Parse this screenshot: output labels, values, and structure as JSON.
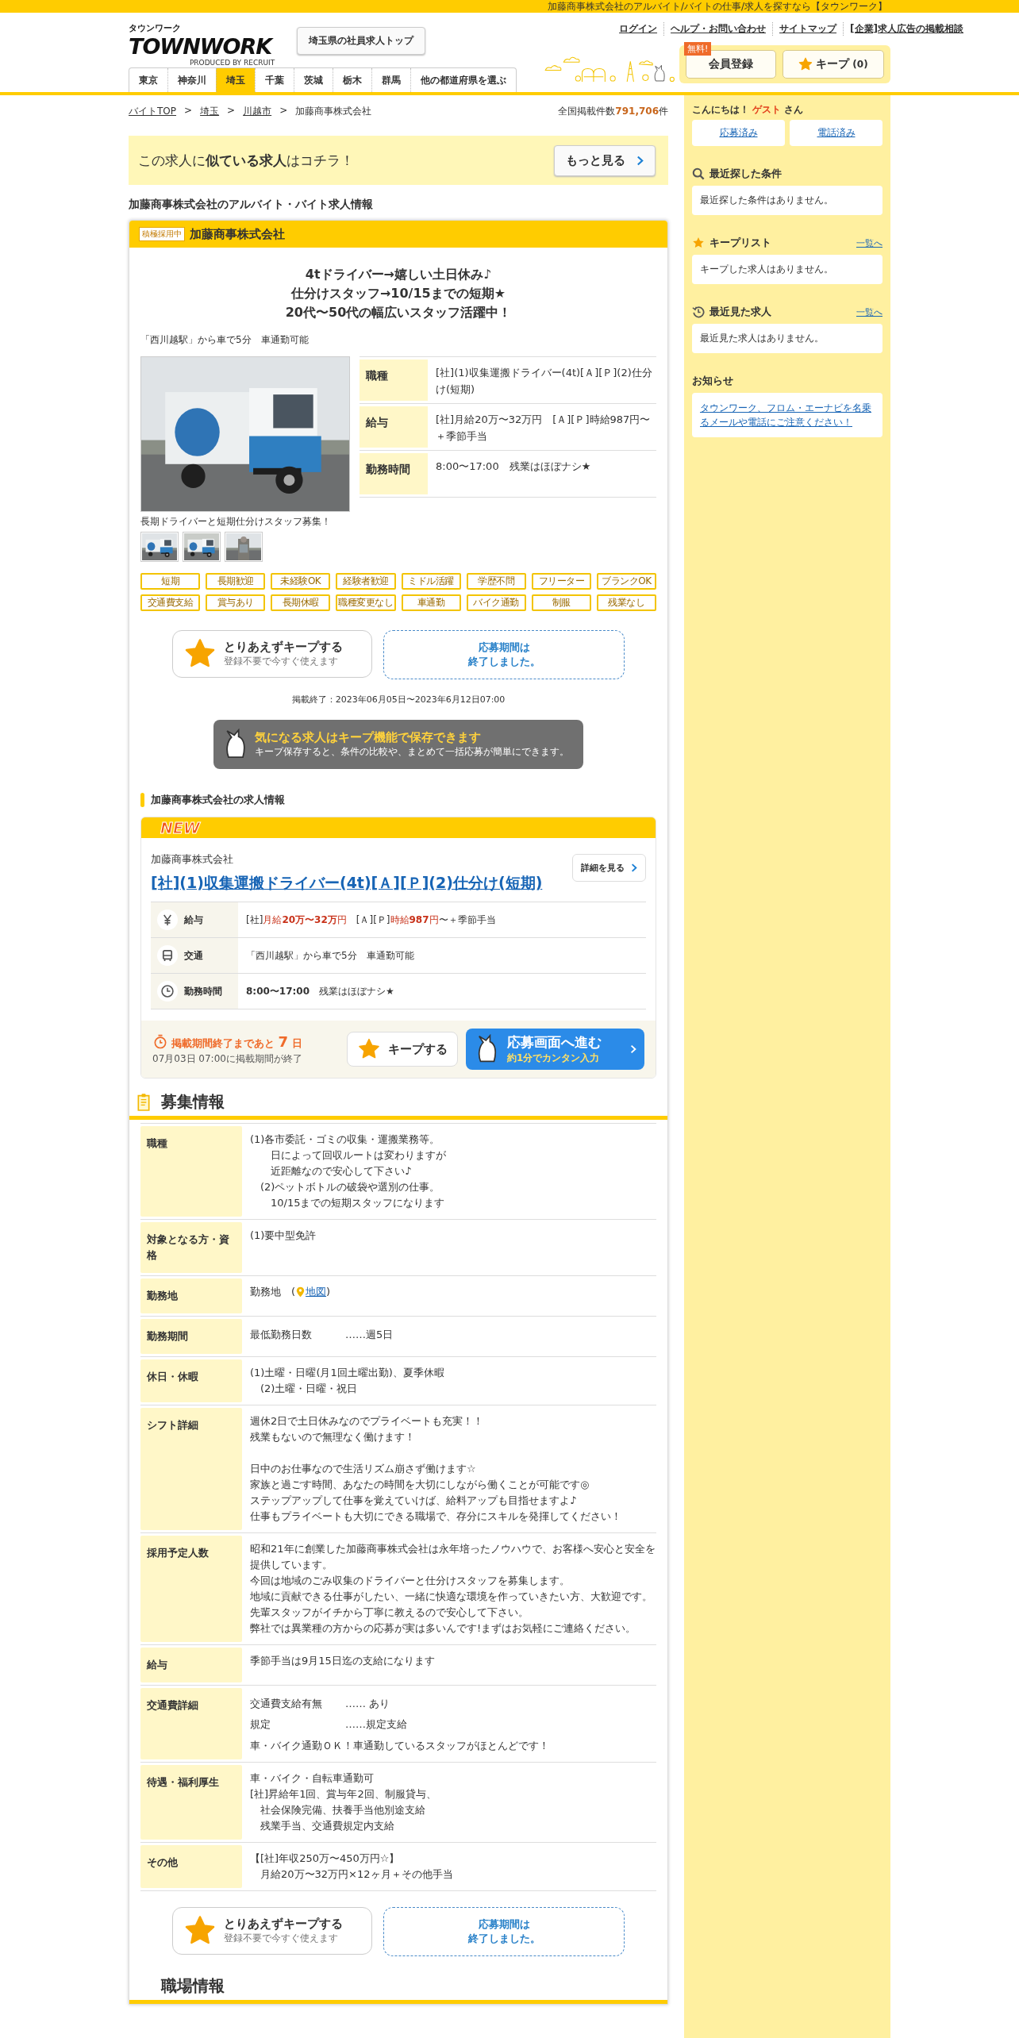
{
  "top_bar": {
    "text": "加藤商事株式会社のアルバイト/バイトの仕事/求人を探すなら【タウンワーク】"
  },
  "logo": {
    "kana": "タウンワーク",
    "wordmark": "TOWNWORK",
    "credit": "PRODUCED BY RECRUIT"
  },
  "top_button": "埼玉県の社員求人トップ",
  "util_links": [
    "ログイン",
    "ヘルプ・お問い合わせ",
    "サイトマップ",
    "[企業]求人広告の掲載相談"
  ],
  "member_button": {
    "badge": "無料!",
    "label": "会員登録"
  },
  "keep_button": {
    "label": "キープ",
    "count": "(0)"
  },
  "prefecture_tabs": [
    {
      "label": "東京",
      "selected": false
    },
    {
      "label": "神奈川",
      "selected": false
    },
    {
      "label": "埼玉",
      "selected": true
    },
    {
      "label": "千葉",
      "selected": false
    },
    {
      "label": "茨城",
      "selected": false
    },
    {
      "label": "栃木",
      "selected": false
    },
    {
      "label": "群馬",
      "selected": false
    },
    {
      "label": "他の都道府県を選ぶ",
      "selected": false
    }
  ],
  "breadcrumb": {
    "separator": ">",
    "items": [
      {
        "label": "バイトTOP",
        "link": true
      },
      {
        "label": "埼玉",
        "link": true
      },
      {
        "label": "川越市",
        "link": true
      },
      {
        "label": "加藤商事株式会社",
        "link": false
      }
    ]
  },
  "total": {
    "label": "全国掲載件数",
    "count": "791,706",
    "unit": "件"
  },
  "similar_banner": {
    "text": "この求人に**似ている求人**はコチラ！",
    "button": "もっと見る"
  },
  "page_heading": "加藤商事株式会社のアルバイト・バイト求人情報",
  "job": {
    "badge": "積極採用中",
    "company": "加藤商事株式会社",
    "catch_lines": [
      "4tドライバー→嬉しい土日休み♪",
      "仕分けスタッフ→10/15までの短期★",
      "20代〜50代の幅広いスタッフ活躍中！"
    ],
    "access": "「西川越駅」から車で5分　車通勤可能",
    "photo": {
      "kind": "picture",
      "caption": "長期ドライバーと短期仕分けスタッフ募集！"
    },
    "thumbnails": [
      {
        "kind": "picture"
      },
      {
        "kind": "picture"
      },
      {
        "kind": "picture"
      }
    ],
    "summary": [
      {
        "label": "職種",
        "value": "[社](1)収集運搬ドライバー(4t)[Ａ][Ｐ](2)仕分け(短期)"
      },
      {
        "label": "給与",
        "value": "[社]月給20万〜32万円　[Ａ][Ｐ]時給987円〜＋季節手当"
      },
      {
        "label": "勤務時間",
        "value": "8:00〜17:00　残業はほぼナシ★"
      }
    ],
    "tags": [
      "短期",
      "長期歓迎",
      "未経験OK",
      "経験者歓迎",
      "ミドル活躍",
      "学歴不問",
      "フリーター",
      "ブランクOK",
      "交通費支給",
      "賞与あり",
      "長期休暇",
      "職種変更なし",
      "車通勤",
      "バイク通勤",
      "制服",
      "残業なし"
    ],
    "keep_action": {
      "title": "とりあえずキープする",
      "sub": "登録不要で今すぐ使えます"
    },
    "closed_notice": [
      "応募期間は",
      "終了しました。"
    ],
    "period": "掲載終了：2023年06月05日〜2023年6月12日07:00",
    "keep_promo": {
      "title": "気になる求人はキープ機能で保存できます",
      "text": "キープ保存すると、条件の比較や、まとめて一括応募が簡単にできます。"
    }
  },
  "listing_section": {
    "title": "加藤商事株式会社の求人情報",
    "badge": "NEW",
    "company": "加藤商事株式会社",
    "title_link": "[社](1)収集運搬ドライバー(4t)[Ａ][Ｐ](2)仕分け(短期)",
    "detail_button": "詳細を見る",
    "rows": [
      {
        "kind": "salary",
        "label": "給与",
        "segments": [
          {
            "text": "[社]",
            "red": false
          },
          {
            "text": "月給**20万〜32万**円",
            "red": true
          },
          {
            "text": "　[Ａ][Ｐ]",
            "red": false
          },
          {
            "text": "時給**987**円",
            "red": true
          },
          {
            "text": "〜＋季節手当",
            "red": false
          }
        ]
      },
      {
        "kind": "transport",
        "label": "交通",
        "segments": [
          {
            "text": "「西川越駅」から車で5分　車通勤可能",
            "red": false
          }
        ]
      },
      {
        "kind": "hours",
        "label": "勤務時間",
        "segments": [
          {
            "text": "**8:00〜17:00**　残業はほぼナシ★",
            "red": false
          }
        ]
      }
    ],
    "deadline": {
      "title": "掲載期間終了まであと **7** 日",
      "sub": "07月03日 07:00に掲載期間が終了"
    },
    "keep": "キープする",
    "apply": {
      "title": "応募画面へ進む",
      "sub": "約1分でカンタン入力"
    }
  },
  "recruit": {
    "title": "募集情報",
    "rows": [
      {
        "label": "職種",
        "kind": "text",
        "paragraphs": [
          [
            "(1)各市委託・ゴミの収集・運搬業務等。",
            "　　日によって回収ルートは変わりますが",
            "　　近距離なので安心して下さい♪",
            "　(2)ペットボトルの破袋や選別の仕事。",
            "　　10/15までの短期スタッフになります"
          ]
        ]
      },
      {
        "label": "対象となる方・資格",
        "kind": "text",
        "paragraphs": [
          [
            "(1)要中型免許"
          ]
        ]
      },
      {
        "label": "勤務地",
        "kind": "map",
        "value": "勤務地　(",
        "link": "地図",
        "after": ")"
      },
      {
        "label": "勤務期間",
        "kind": "pairs",
        "pairs": [
          {
            "key": "最低勤務日数",
            "value": "……週5日"
          }
        ]
      },
      {
        "label": "休日・休暇",
        "kind": "text",
        "paragraphs": [
          [
            "(1)土曜・日曜(月1回土曜出勤)、夏季休暇",
            "　(2)土曜・日曜・祝日"
          ]
        ]
      },
      {
        "label": "シフト詳細",
        "kind": "text",
        "paragraphs": [
          [
            "週休2日で土日休みなのでプライベートも充実！！",
            "残業もないので無理なく働けます！"
          ],
          [
            "日中のお仕事なので生活リズム崩さず働けます☆",
            "家族と過ごす時間、あなたの時間を大切にしながら働くことが可能です◎",
            "ステップアップして仕事を覚えていけば、給料アップも目指せますよ♪",
            "仕事もプライベートも大切にできる職場で、存分にスキルを発揮してください！"
          ]
        ]
      },
      {
        "label": "採用予定人数",
        "kind": "text",
        "paragraphs": [
          [
            "昭和21年に創業した加藤商事株式会社は永年培ったノウハウで、お客様へ安心と安全を提供しています。",
            "今回は地域のごみ収集のドライバーと仕分けスタッフを募集します。",
            "地域に貢献できる仕事がしたい、一緒に快適な環境を作っていきたい方、大歓迎です。",
            "先輩スタッフがイチから丁寧に教えるので安心して下さい。",
            "弊社では異業種の方からの応募が実は多いんです!まずはお気軽にご連絡ください。"
          ]
        ]
      },
      {
        "label": "給与",
        "kind": "text",
        "paragraphs": [
          [
            "季節手当は9月15日迄の支給になります"
          ]
        ]
      },
      {
        "label": "交通費詳細",
        "kind": "pairs",
        "pairs": [
          {
            "key": "交通費支給有無",
            "value": "…… あり"
          },
          {
            "key": "規定",
            "value": "……規定支給"
          }
        ],
        "note": "車・バイク通勤ＯＫ！車通勤しているスタッフがほとんどです！"
      },
      {
        "label": "待遇・福利厚生",
        "kind": "text",
        "paragraphs": [
          [
            "車・バイク・自転車通勤可",
            "[社]昇給年1回、賞与年2回、制服貸与、",
            "　社会保険完備、扶養手当他別途支給",
            "　残業手当、交通費規定内支給"
          ]
        ]
      },
      {
        "label": "その他",
        "kind": "text",
        "paragraphs": [
          [
            "【[社]年収250万〜450万円☆】",
            "　月給20万〜32万円×12ヶ月＋その他手当"
          ]
        ]
      }
    ]
  },
  "bottom_actions": {
    "keep_action": {
      "title": "とりあえずキープする",
      "sub": "登録不要で今すぐ使えます"
    },
    "closed_notice": [
      "応募期間は",
      "終了しました。"
    ]
  },
  "workplace": {
    "title": "職場情報"
  },
  "sidebar": {
    "greeting": "こんにちは！",
    "user": "ゲスト",
    "honorific": "さん",
    "buttons": [
      "応募済み",
      "電話済み"
    ],
    "sections": [
      {
        "kind": "search",
        "title": "最近探した条件",
        "empty": "最近探した条件はありません。"
      },
      {
        "kind": "keep",
        "title": "キープリスト",
        "link": "一覧へ",
        "empty": "キープした求人はありません。"
      },
      {
        "kind": "history",
        "title": "最近見た求人",
        "link": "一覧へ",
        "empty": "最近見た求人はありません。"
      }
    ],
    "notice": {
      "title": "お知らせ",
      "link": "タウンワーク、フロム・エーナビを名乗るメールや電話にご注意ください！"
    }
  }
}
